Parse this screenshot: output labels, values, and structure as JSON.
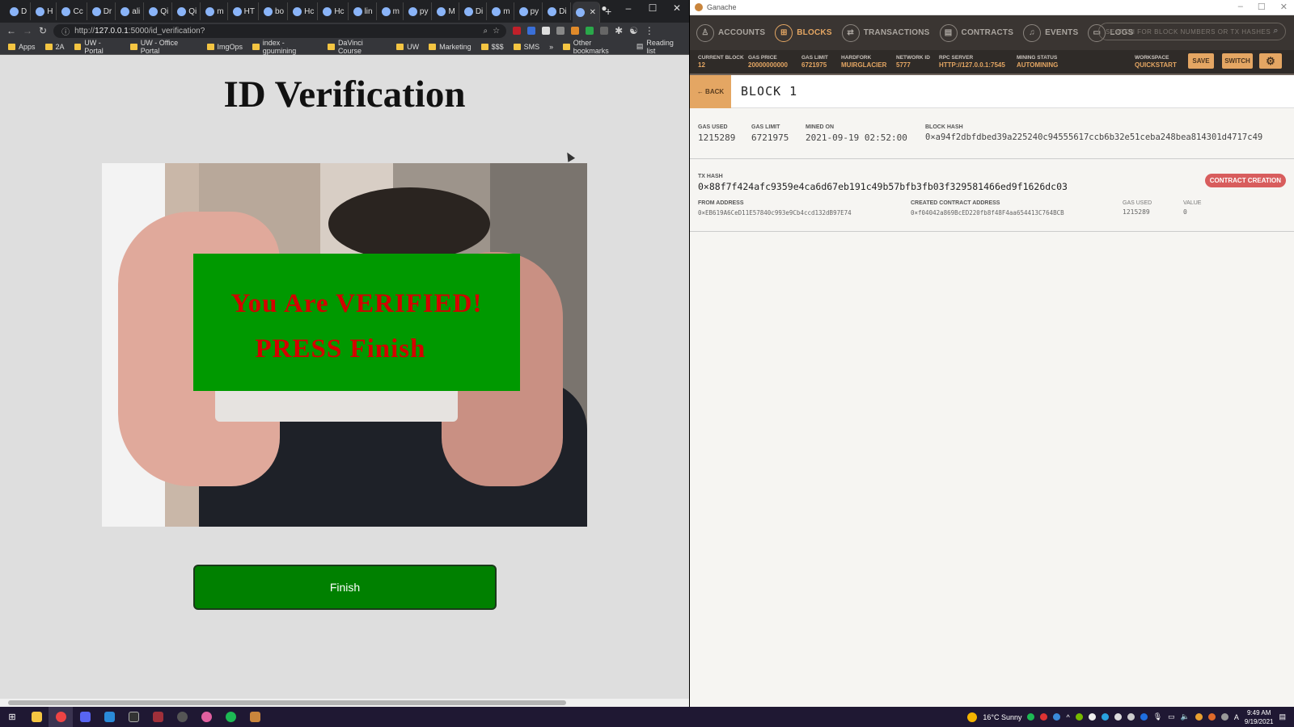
{
  "browser": {
    "tabs": [
      "D",
      "H",
      "Cc",
      "Dr",
      "ali",
      "Qi",
      "Qi",
      "m",
      "HT",
      "bo",
      "Hc",
      "Hc",
      "lin",
      "m",
      "py",
      "M",
      "Di",
      "m",
      "py",
      "Di",
      ""
    ],
    "new_tab": "+",
    "url_prefix": "http://",
    "url_host": "127.0.0.1",
    "url_rest": ":5000/id_verification?",
    "bookmarks": [
      "Apps",
      "2A",
      "UW - Portal",
      "UW - Office Portal",
      "ImgOps",
      "index - gpumining",
      "DaVinci Course",
      "UW",
      "Marketing",
      "$$$",
      "SMS"
    ],
    "more": "»",
    "other_bookmarks": "Other bookmarks",
    "reading_list": "Reading list"
  },
  "page": {
    "title": "ID Verification",
    "verified_line1": "You Are VERIFIED!",
    "verified_line2": "PRESS Finish",
    "finish_label": "Finish",
    "colors": {
      "box": "#009900",
      "text": "#d40000",
      "button": "#008000"
    }
  },
  "ganache": {
    "window_title": "Ganache",
    "nav": [
      {
        "label": "ACCOUNTS",
        "icon": "user-icon"
      },
      {
        "label": "BLOCKS",
        "icon": "grid-icon",
        "active": true
      },
      {
        "label": "TRANSACTIONS",
        "icon": "arrows-icon"
      },
      {
        "label": "CONTRACTS",
        "icon": "document-icon"
      },
      {
        "label": "EVENTS",
        "icon": "bell-icon"
      },
      {
        "label": "LOGS",
        "icon": "terminal-icon"
      }
    ],
    "search_placeholder": "SEARCH FOR BLOCK NUMBERS OR TX HASHES",
    "stats": [
      {
        "label": "CURRENT BLOCK",
        "value": "12"
      },
      {
        "label": "GAS PRICE",
        "value": "20000000000"
      },
      {
        "label": "GAS LIMIT",
        "value": "6721975"
      },
      {
        "label": "HARDFORK",
        "value": "MUIRGLACIER"
      },
      {
        "label": "NETWORK ID",
        "value": "5777"
      },
      {
        "label": "RPC SERVER",
        "value": "HTTP://127.0.0.1:7545"
      },
      {
        "label": "MINING STATUS",
        "value": "AUTOMINING"
      }
    ],
    "workspace": {
      "label": "WORKSPACE",
      "value": "QUICKSTART"
    },
    "save": "SAVE",
    "switch": "SWITCH",
    "back": "← BACK",
    "block_title": "BLOCK 1",
    "block": {
      "gas_used_label": "GAS USED",
      "gas_used": "1215289",
      "gas_limit_label": "GAS LIMIT",
      "gas_limit": "6721975",
      "mined_on_label": "MINED ON",
      "mined_on": "2021-09-19 02:52:00",
      "hash_label": "BLOCK HASH",
      "hash": "0×a94f2dbfdbed39a225240c94555617ccb6b32e51ceba248bea814301d4717c49"
    },
    "tx": {
      "hash_label": "TX HASH",
      "hash": "0×88f7f424afc9359e4ca6d67eb191c49b57bfb3fb03f329581466ed9f1626dc03",
      "badge": "CONTRACT CREATION",
      "from_label": "FROM ADDRESS",
      "from": "0×EB619A6CeD11E57840c993e9Cb4ccd132dB97E74",
      "created_label": "CREATED CONTRACT ADDRESS",
      "created": "0×f04042a869BcED220fb8f48F4aa654413C764BCB",
      "gas_label": "GAS USED",
      "gas": "1215289",
      "value_label": "VALUE",
      "value": "0"
    }
  },
  "taskbar": {
    "weather": "16°C  Sunny",
    "time": "9:49 AM",
    "date": "9/19/2021",
    "lang": "A"
  }
}
